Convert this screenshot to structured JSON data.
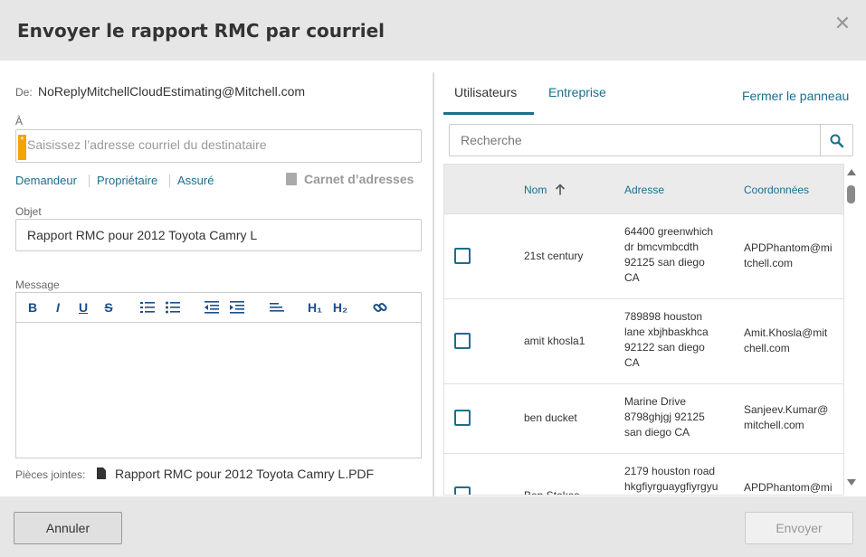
{
  "dialog": {
    "title": "Envoyer le rapport RMC par courriel",
    "close_glyph": "✕"
  },
  "form": {
    "from_label": "De:",
    "from_value": "NoReplyMitchellCloudEstimating@Mitchell.com",
    "to_label": "À",
    "to_required_mark": "*",
    "to_placeholder": "Saisissez l’adresse courriel du destinataire",
    "quick_links": [
      "Demandeur",
      "Propriétaire",
      "Assuré"
    ],
    "address_book_label": "Carnet d’adresses",
    "subject_label": "Objet",
    "subject_value": "Rapport RMC pour 2012 Toyota Camry L",
    "message_label": "Message",
    "attachments_label": "Pièces jointes:",
    "attachment_file": "Rapport RMC pour 2012 Toyota Camry L.PDF"
  },
  "toolbar": {
    "bold": "B",
    "italic": "I",
    "underline": "U",
    "strike": "S",
    "h1": "H₁",
    "h2": "H₂"
  },
  "panel": {
    "tabs": [
      "Utilisateurs",
      "Entreprise"
    ],
    "active_tab": "Utilisateurs",
    "close_label": "Fermer le panneau",
    "search_placeholder": "Recherche",
    "columns": [
      "Nom",
      "Adresse",
      "Coordonnées"
    ],
    "sort_column": "Nom",
    "rows": [
      {
        "name": "21st century",
        "address": [
          "64400 greenwhich",
          "dr bmcvmbcdth",
          "92125 san diego",
          "CA"
        ],
        "contact": [
          "APDPhantom@mi",
          "tchell.com"
        ]
      },
      {
        "name": "amit khosla1",
        "address": [
          "789898 houston",
          "lane xbjhbaskhca",
          "92122 san diego",
          "CA"
        ],
        "contact": [
          "Amit.Khosla@mit",
          "chell.com"
        ]
      },
      {
        "name": "ben ducket",
        "address": [
          "Marine Drive",
          "8798ghjgj 92125",
          "san diego CA"
        ],
        "contact": [
          "Sanjeev.Kumar@",
          "mitchell.com"
        ]
      },
      {
        "name": "Ben Stokes",
        "address": [
          "2179 houston road",
          "hkgfiyrguaygfiyrgyu"
        ],
        "contact": [
          "APDPhantom@mi"
        ]
      }
    ]
  },
  "footer": {
    "cancel_label": "Annuler",
    "send_label": "Envoyer"
  },
  "colors": {
    "accent": "#1a6e8e",
    "required": "#f0a500",
    "header_bg": "#e6e6e6"
  }
}
